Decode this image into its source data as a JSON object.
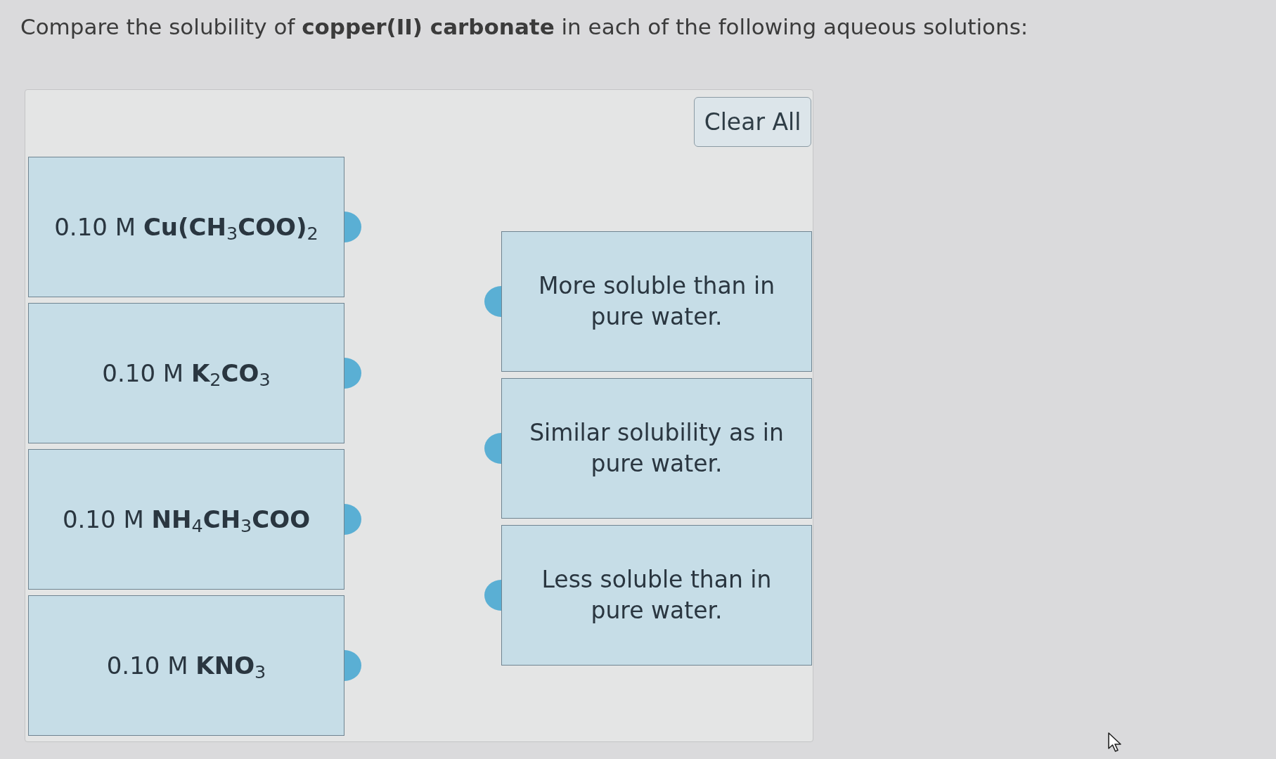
{
  "question": {
    "text": "Compare the solubility of **copper(II) carbonate** in each of the following aqueous solutions:"
  },
  "clear_button": {
    "label": "Clear All"
  },
  "solutions": [
    {
      "label": "0.10 M **Cu(CH**$_{3}$**COO)**$_{2}$"
    },
    {
      "label": "0.10 M **K**$_{2}$**CO**$_{3}$"
    },
    {
      "label": "0.10 M **NH**$_{4}$**CH**$_{3}$**COO**"
    },
    {
      "label": "0.10 M **KNO**$_{3}$"
    }
  ],
  "answers": [
    {
      "label": "More soluble than in pure water."
    },
    {
      "label": "Similar solubility as in pure water."
    },
    {
      "label": "Less soluble than in pure water."
    }
  ]
}
